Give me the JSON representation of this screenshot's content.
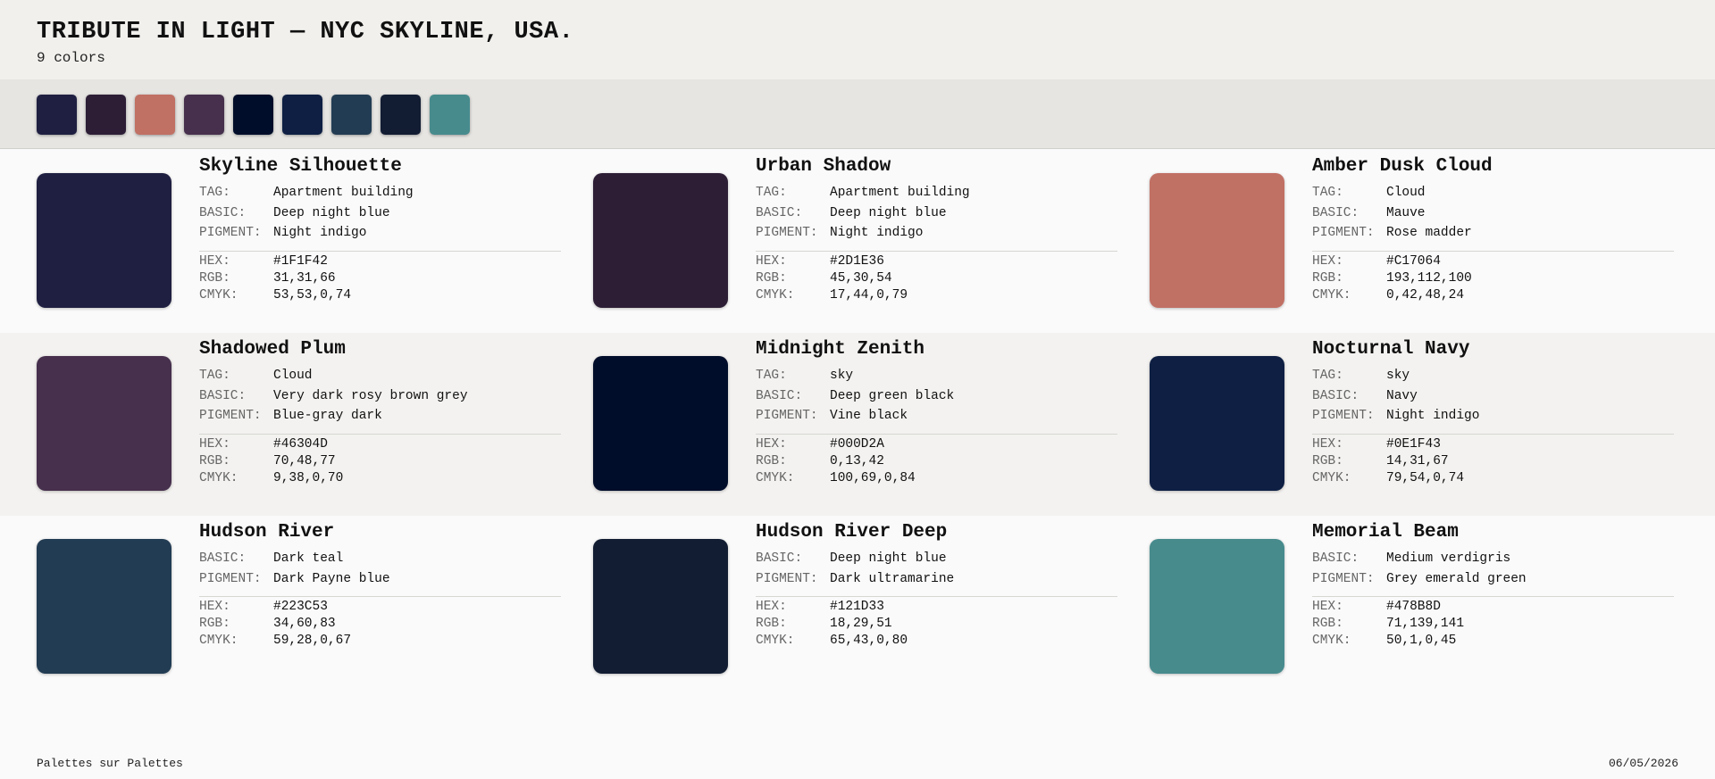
{
  "header": {
    "title": "TRIBUTE IN LIGHT — NYC SKYLINE, USA.",
    "count": "9 colors"
  },
  "labels": {
    "tag": "TAG:",
    "basic": "BASIC:",
    "pigment": "PIGMENT:",
    "hex": "HEX:",
    "rgb": "RGB:",
    "cmyk": "CMYK:"
  },
  "colors": [
    {
      "name": "Skyline Silhouette",
      "tag": "Apartment building",
      "basic": "Deep night blue",
      "pigment": "Night indigo",
      "hex": "#1F1F42",
      "rgb": "31,31,66",
      "cmyk": "53,53,0,74"
    },
    {
      "name": "Urban Shadow",
      "tag": "Apartment building",
      "basic": "Deep night blue",
      "pigment": "Night indigo",
      "hex": "#2D1E36",
      "rgb": "45,30,54",
      "cmyk": "17,44,0,79"
    },
    {
      "name": "Amber Dusk Cloud",
      "tag": "Cloud",
      "basic": "Mauve",
      "pigment": "Rose madder",
      "hex": "#C17064",
      "rgb": "193,112,100",
      "cmyk": "0,42,48,24"
    },
    {
      "name": "Shadowed Plum",
      "tag": "Cloud",
      "basic": "Very dark rosy brown grey",
      "pigment": "Blue-gray dark",
      "hex": "#46304D",
      "rgb": "70,48,77",
      "cmyk": "9,38,0,70"
    },
    {
      "name": "Midnight Zenith",
      "tag": "sky",
      "basic": "Deep green black",
      "pigment": "Vine black",
      "hex": "#000D2A",
      "rgb": "0,13,42",
      "cmyk": "100,69,0,84"
    },
    {
      "name": "Nocturnal Navy",
      "tag": "sky",
      "basic": "Navy",
      "pigment": "Night indigo",
      "hex": "#0E1F43",
      "rgb": "14,31,67",
      "cmyk": "79,54,0,74"
    },
    {
      "name": "Hudson River",
      "tag": "",
      "basic": "Dark teal",
      "pigment": "Dark Payne blue",
      "hex": "#223C53",
      "rgb": "34,60,83",
      "cmyk": "59,28,0,67"
    },
    {
      "name": "Hudson River Deep",
      "tag": "",
      "basic": "Deep night blue",
      "pigment": "Dark ultramarine",
      "hex": "#121D33",
      "rgb": "18,29,51",
      "cmyk": "65,43,0,80"
    },
    {
      "name": "Memorial Beam",
      "tag": "",
      "basic": "Medium verdigris",
      "pigment": "Grey emerald green",
      "hex": "#478B8D",
      "rgb": "71,139,141",
      "cmyk": "50,1,0,45"
    }
  ],
  "footer": {
    "brand": "Palettes sur Palettes",
    "date": "06/05/2026"
  }
}
